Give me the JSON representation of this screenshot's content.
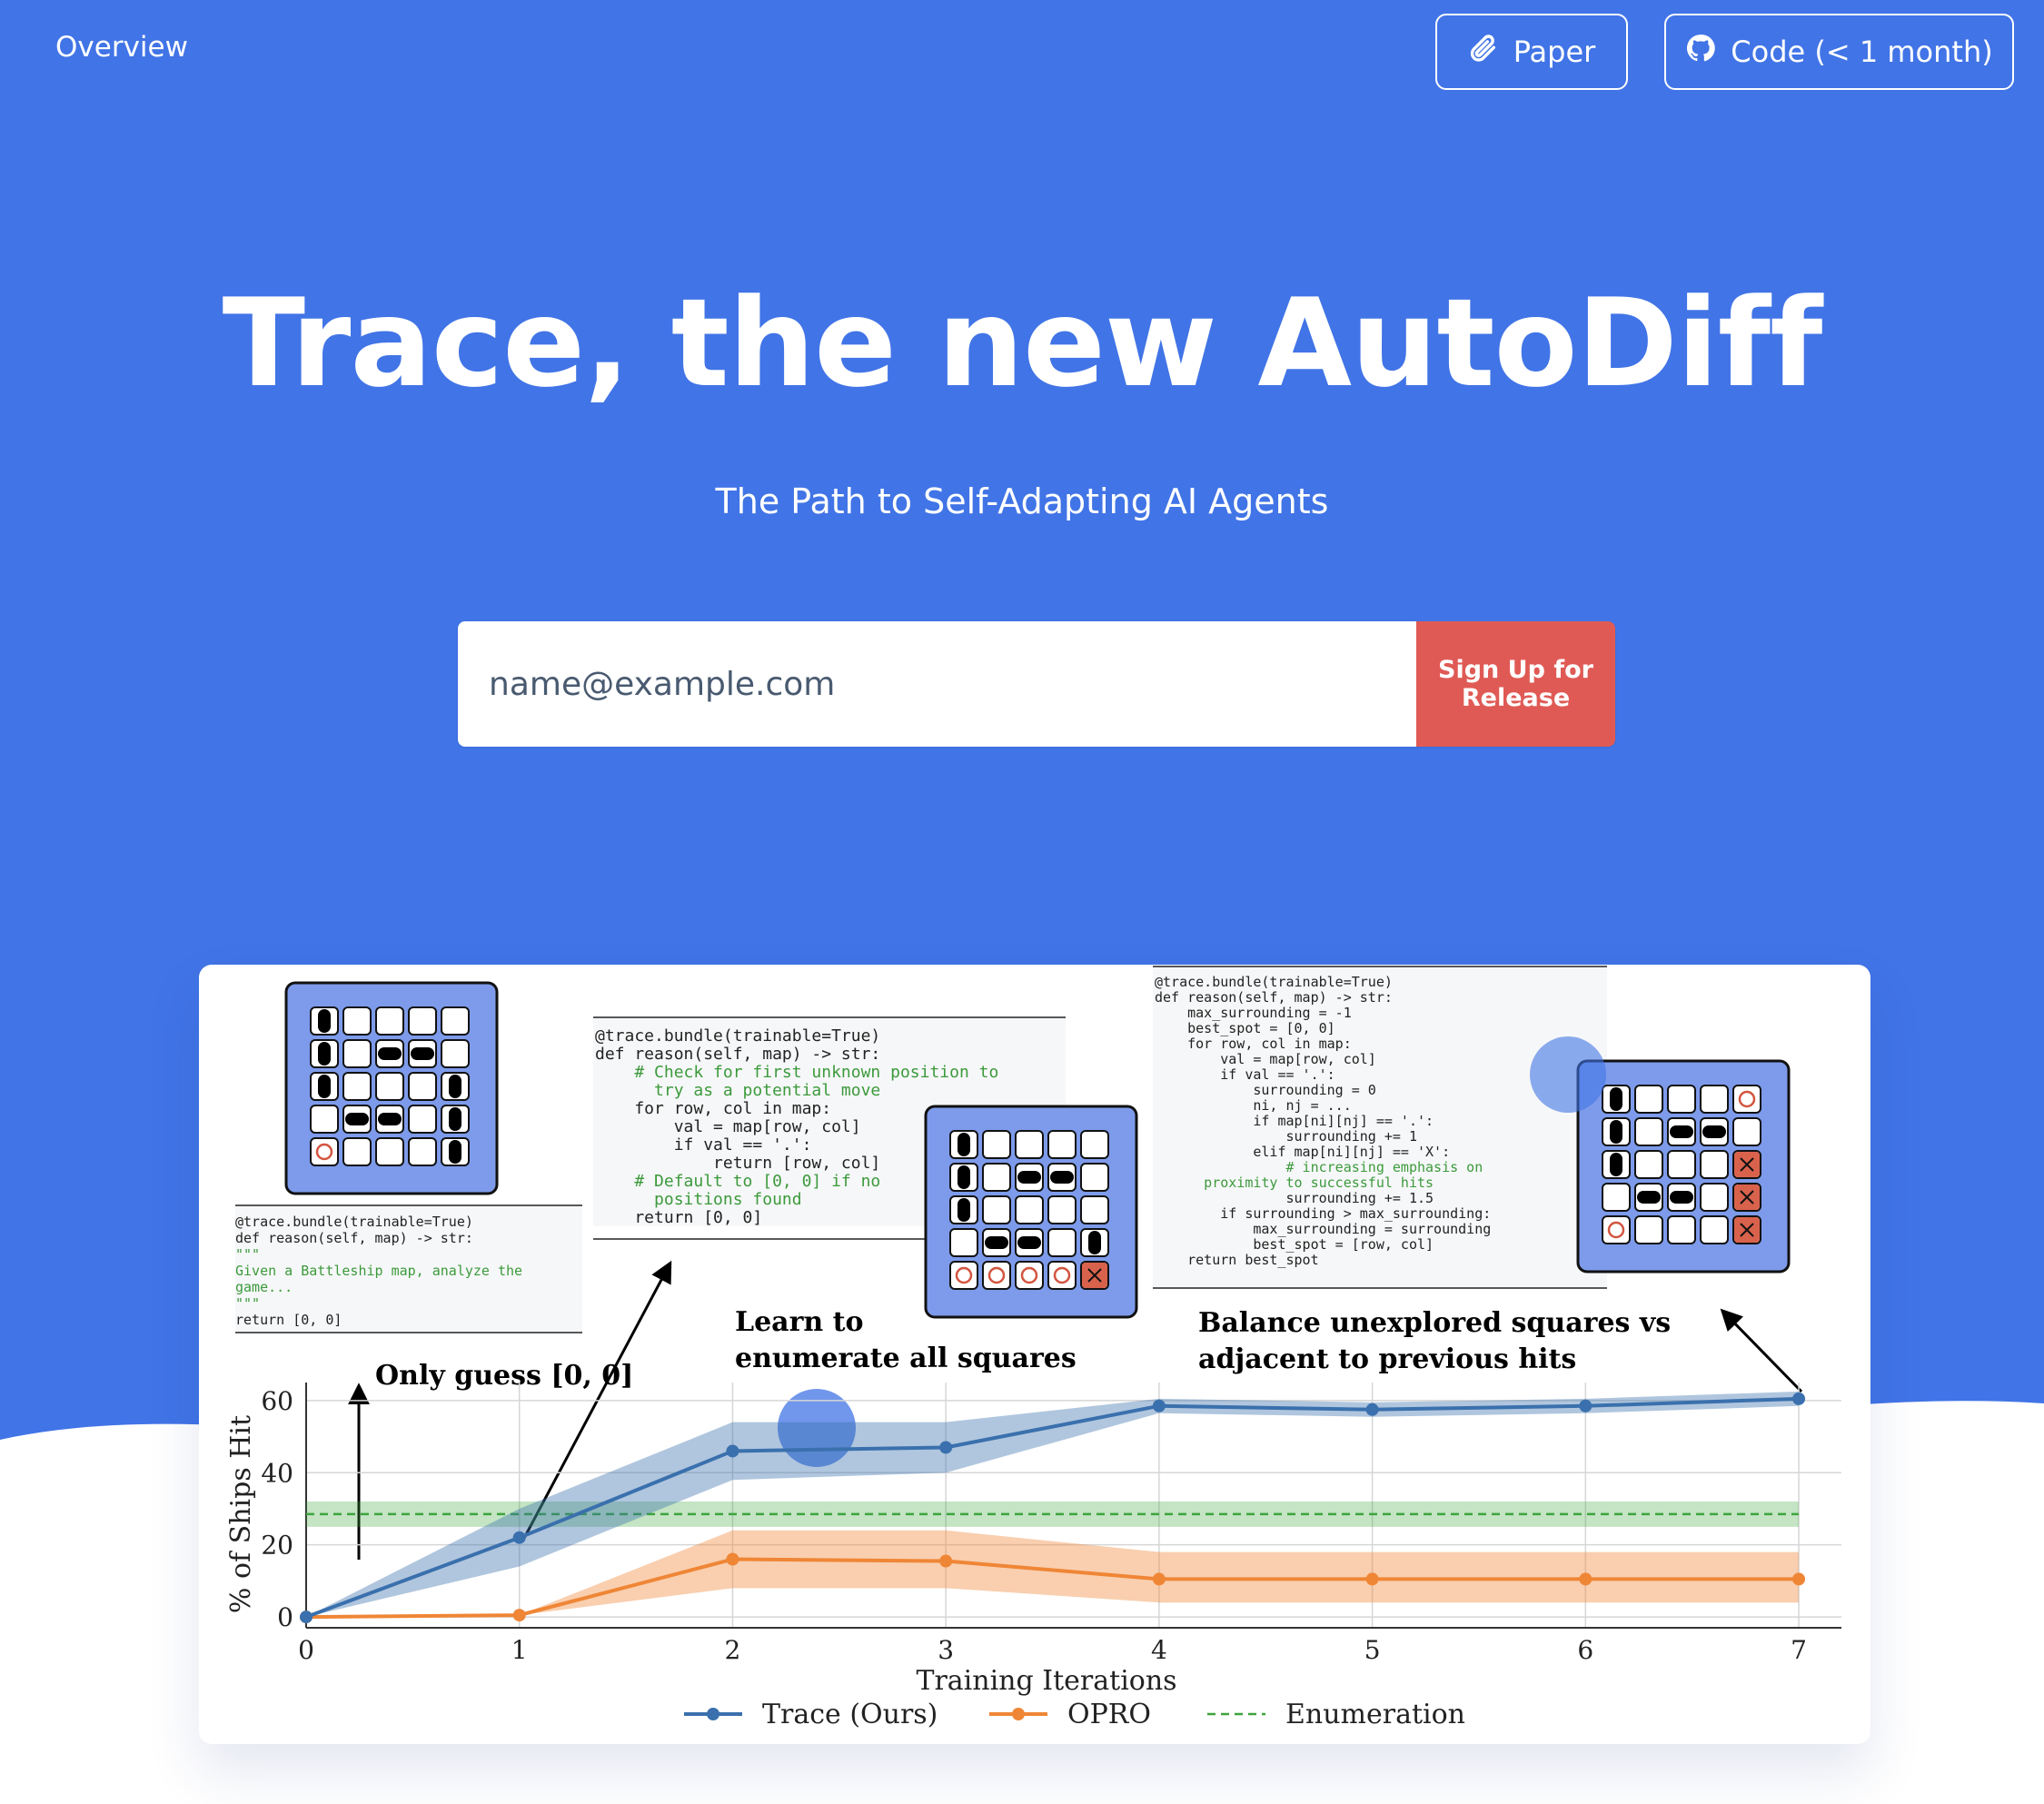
{
  "nav": {
    "overview": "Overview",
    "paper_label": "Paper",
    "code_label": "Code (< 1 month)",
    "paper_icon": "paperclip-icon",
    "code_icon": "github-icon"
  },
  "hero": {
    "title": "Trace, the new AutoDiff",
    "subtitle": "The Path to Self-Adapting AI Agents",
    "email_placeholder": "name@example.com",
    "signup_label": "Sign Up for Release",
    "bg_color": "#4174e6",
    "button_color": "#e05a55"
  },
  "figure": {
    "code_panels": [
      {
        "lines": [
          "@trace.bundle(trainable=True)",
          "def reason(self, map) -> str:",
          "\"\"\"",
          "Given a Battleship map, analyze the",
          "    game...",
          "\"\"\"",
          "return [0, 0]"
        ]
      },
      {
        "lines": [
          "@trace.bundle(trainable=True)",
          "def reason(self, map) -> str:",
          "    # Check for first unknown position to",
          "      try as a potential move",
          "    for row, col in map:",
          "        val = map[row, col]",
          "        if val == '.':",
          "            return [row, col]",
          "    # Default to [0, 0] if no",
          "      positions found",
          "    return [0, 0]"
        ]
      },
      {
        "lines": [
          "@trace.bundle(trainable=True)",
          "def reason(self, map) -> str:",
          "    max_surrounding = -1",
          "    best_spot = [0, 0]",
          "    for row, col in map:",
          "        val = map[row, col]",
          "        if val == '.':",
          "            surrounding = 0",
          "            ni, nj = ...",
          "            if map[ni][nj] == '.':",
          "                surrounding += 1",
          "            elif map[ni][nj] == 'X':",
          "                # increasing emphasis on",
          "      proximity to successful hits",
          "                surrounding += 1.5",
          "        if surrounding > max_surrounding:",
          "            max_surrounding = surrounding",
          "            best_spot = [row, col]",
          "    return best_spot"
        ]
      }
    ],
    "annotations": [
      "Only guess [0, 0]",
      "Learn to",
      "enumerate all squares",
      "Balance unexplored squares vs",
      "adjacent to previous hits"
    ]
  },
  "chart_data": {
    "type": "line",
    "x": [
      0,
      1,
      2,
      3,
      4,
      5,
      6,
      7
    ],
    "xticks": [
      "0",
      "1",
      "2",
      "3",
      "4",
      "5",
      "6",
      "7"
    ],
    "yticks": [
      "0",
      "20",
      "40",
      "60"
    ],
    "xlabel": "Training Iterations",
    "ylabel": "% of Ships Hit",
    "xlim": [
      0,
      7.2
    ],
    "ylim": [
      -3,
      65
    ],
    "grid": true,
    "legend_position": "bottom",
    "series": [
      {
        "name": "Trace (Ours)",
        "color": "#3a70ad",
        "values": [
          0,
          22,
          46,
          47,
          58.5,
          57.5,
          58.5,
          60.5
        ],
        "lower": [
          0,
          14,
          38,
          40,
          56.5,
          55.5,
          56.5,
          58.5
        ],
        "upper": [
          0,
          30,
          54,
          54,
          60.5,
          59.5,
          60.5,
          62.5
        ]
      },
      {
        "name": "OPRO",
        "color": "#ef8636",
        "values": [
          0,
          0.5,
          16,
          15.5,
          10.5,
          10.5,
          10.5,
          10.5
        ],
        "lower": [
          0,
          0.5,
          8,
          8,
          4,
          4,
          4,
          4
        ],
        "upper": [
          0,
          0.5,
          24,
          24,
          18,
          18,
          18,
          18
        ]
      },
      {
        "name": "Enumeration",
        "color": "#3da43d",
        "dashed": true,
        "values": [
          28.5,
          28.5,
          28.5,
          28.5,
          28.5,
          28.5,
          28.5,
          28.5
        ],
        "lower": [
          25,
          25,
          25,
          25,
          25,
          25,
          25,
          25
        ],
        "upper": [
          32,
          32,
          32,
          32,
          32,
          32,
          32,
          32
        ]
      }
    ]
  }
}
